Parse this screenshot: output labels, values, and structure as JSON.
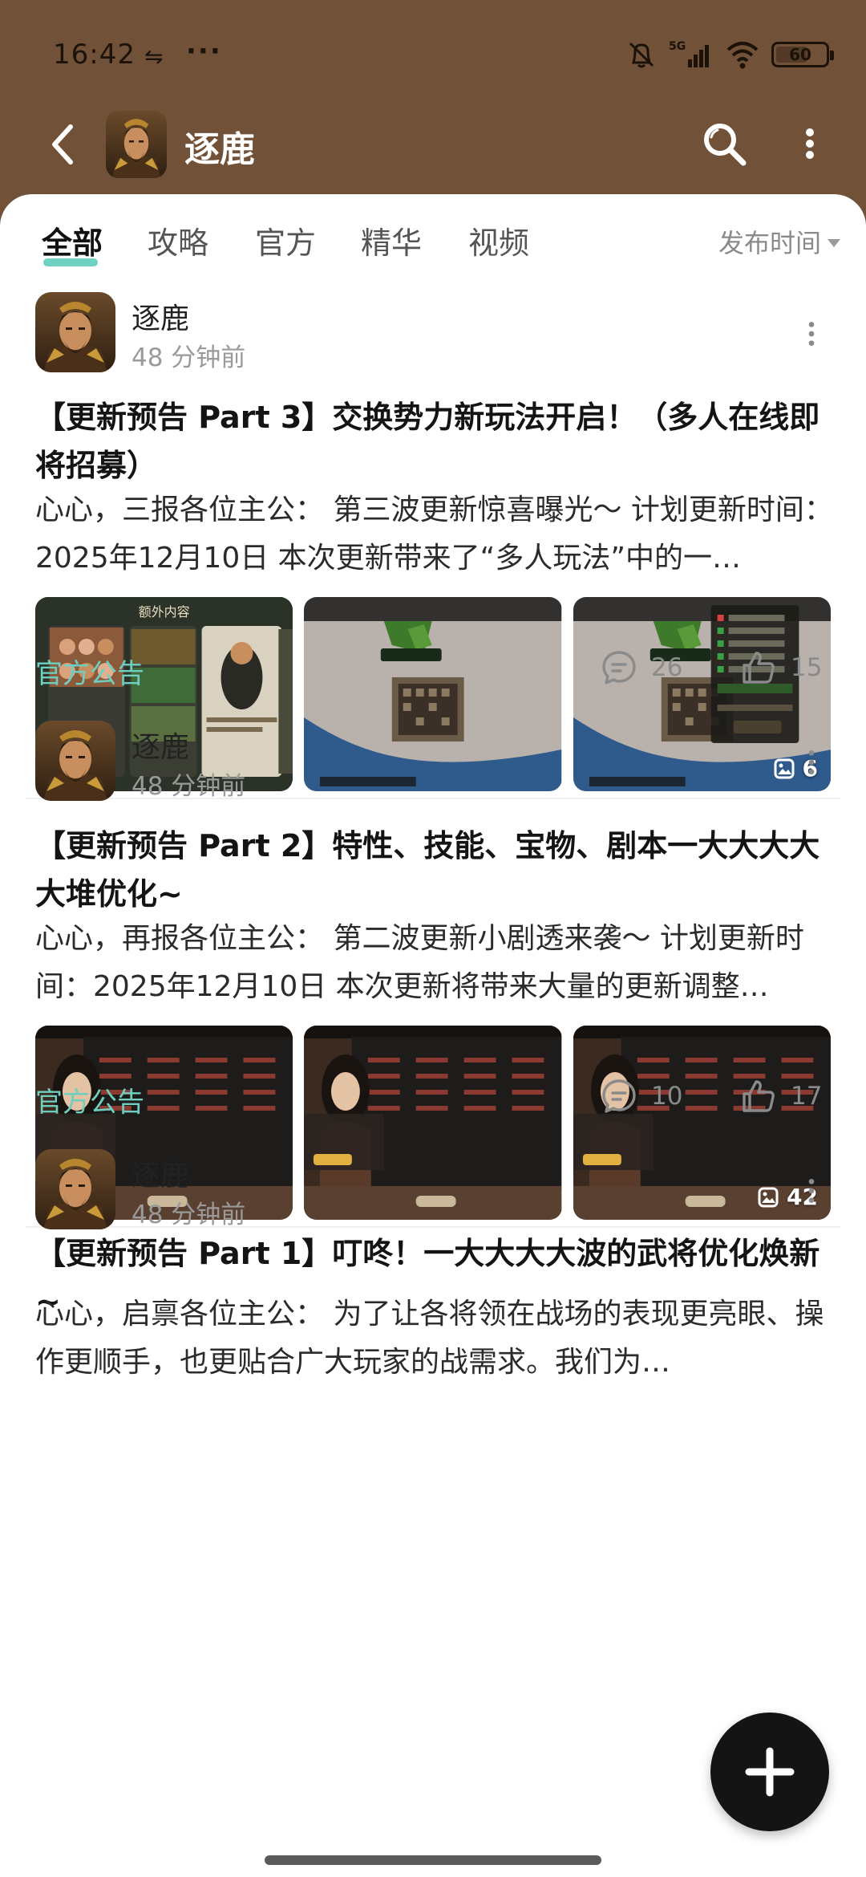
{
  "status_bar": {
    "time": "16:42",
    "usb_glyph": "⇋",
    "more_glyph": "···",
    "network": "5G",
    "battery": "60"
  },
  "header": {
    "title": "逐鹿"
  },
  "tabs": [
    {
      "label": "全部"
    },
    {
      "label": "攻略"
    },
    {
      "label": "官方"
    },
    {
      "label": "精华"
    },
    {
      "label": "视频"
    }
  ],
  "sort": {
    "label": "发布时间"
  },
  "posts": [
    {
      "author": "逐鹿",
      "time": "48 分钟前",
      "title": "【更新预告 Part 3】交换势力新玩法开启！（多人在线即将招募）",
      "body": "心心，三报各位主公： 第三波更新惊喜曝光～ 计划更新时间：2025年12月10日 本次更新带来了“多人玩法”中的一…",
      "image_count": "6",
      "tag": "官方公告",
      "comments": "26",
      "likes": "15"
    },
    {
      "author": "逐鹿",
      "time": "48 分钟前",
      "title": "【更新预告 Part 2】特性、技能、宝物、剧本一大大大大大堆优化~",
      "body": "心心，再报各位主公： 第二波更新小剧透来袭～ 计划更新时间：2025年12月10日 本次更新将带来大量的更新调整…",
      "image_count": "42",
      "tag": "官方公告",
      "comments": "10",
      "likes": "17"
    },
    {
      "author": "逐鹿",
      "time": "48 分钟前",
      "title": "【更新预告 Part 1】叮咚！一大大大大波的武将优化焕新~",
      "body": "心心，启禀各位主公： 为了让各将领在战场的表现更亮眼、操作更顺手，也更贴合广大玩家的战需求。我们为…"
    }
  ],
  "colors": {
    "header_bg": "#715138",
    "accent_teal": "#6ed3c3",
    "tag_teal": "#6ecfc0"
  }
}
